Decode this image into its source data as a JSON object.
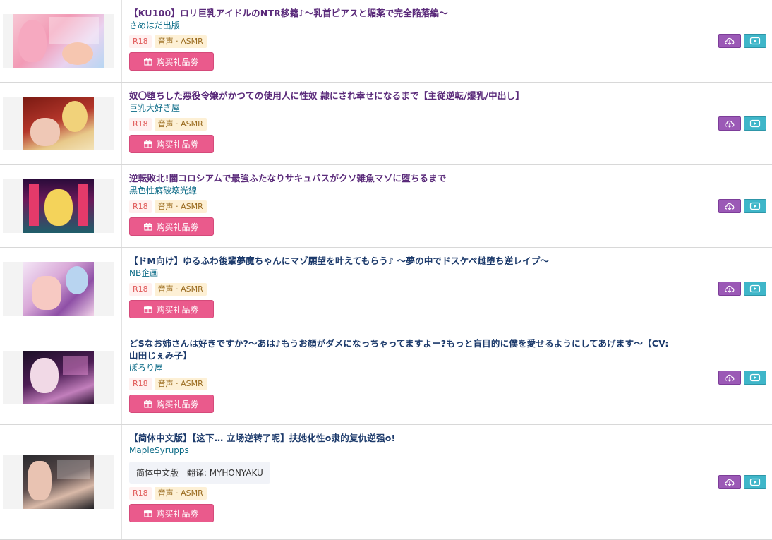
{
  "colors": {
    "title_purple": "#5a2a7a",
    "circle_teal": "#0a6a86",
    "buy_pink": "#ea5a8c",
    "download_purple": "#9b59b6",
    "play_teal": "#3fb6c9",
    "r18_red": "#e05959",
    "genre_tan": "#fdf0d5"
  },
  "buy_label": "购买礼品劵",
  "items": [
    {
      "title": "【KU100】ロリ巨乳アイドルのNTR移籍♪～乳首ピアスと媚薬で完全陥落編～",
      "circle": "さめはだ出版",
      "tag_r18": "R18",
      "tag_genre": "音声 · ASMR",
      "icons": {
        "download": "cloud-download-icon",
        "play": "play-icon"
      }
    },
    {
      "title": "奴〇堕ちした悪役令嬢がかつての使用人に性奴 隷にされ幸せになるまで【主従逆転/爆乳/中出し】",
      "circle": "巨乳大好き屋",
      "tag_r18": "R18",
      "tag_genre": "音声 · ASMR",
      "icons": {
        "download": "cloud-download-icon",
        "play": "play-icon"
      }
    },
    {
      "title": "逆転敗北!闇コロシアムで最強ふたなりサキュバスがクソ雑魚マゾに堕ちるまで",
      "circle": "黒色性癖破壊光線",
      "tag_r18": "R18",
      "tag_genre": "音声 · ASMR",
      "icons": {
        "download": "cloud-download-icon",
        "play": "play-icon"
      }
    },
    {
      "title": "【ドM向け】ゆるふわ後輩夢魔ちゃんにマゾ願望を叶えてもらう♪ ～夢の中でドスケベ雌堕ち逆レイプ～",
      "circle": "NB企画",
      "tag_r18": "R18",
      "tag_genre": "音声 · ASMR",
      "icons": {
        "download": "cloud-download-icon",
        "play": "play-icon"
      }
    },
    {
      "title": "どSなお姉さんは好きですか?～あは♪もうお顔がダメになっちゃってますよー?もっと盲目的に僕を愛せるようにしてあげます～【CV:山田じぇみ子】",
      "circle": "ぽろり屋",
      "tag_r18": "R18",
      "tag_genre": "音声 · ASMR",
      "icons": {
        "download": "cloud-download-icon",
        "play": "play-icon"
      }
    },
    {
      "title": "【简体中文版】【这下… 立场逆转了呢】扶她化性o隶的复仇逆强o!",
      "circle": "MapleSyrupps",
      "translation": {
        "label": "简体中文版",
        "translator": "翻译: MYHONYAKU"
      },
      "tag_r18": "R18",
      "tag_genre": "音声 · ASMR",
      "icons": {
        "download": "cloud-download-icon",
        "play": "play-icon"
      }
    }
  ]
}
